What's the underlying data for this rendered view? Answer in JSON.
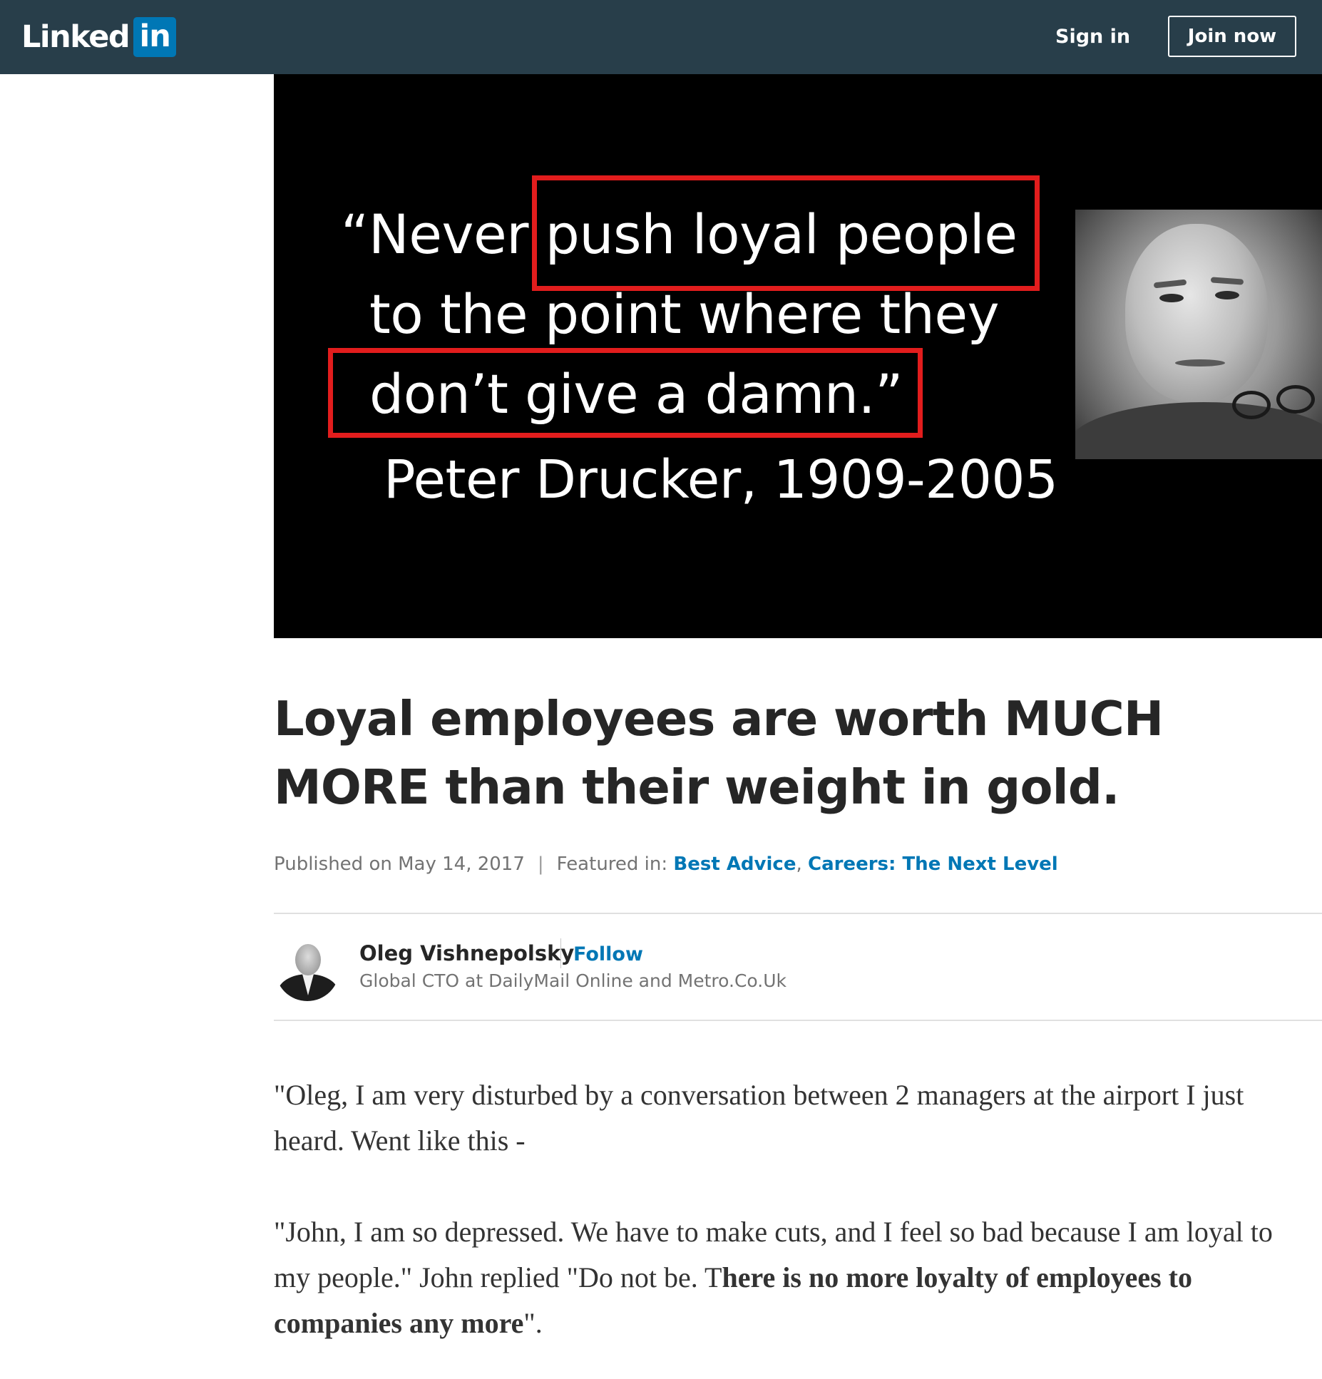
{
  "header": {
    "logo_word": "Linked",
    "logo_box": "in",
    "signin_label": "Sign in",
    "join_label": "Join now"
  },
  "hero": {
    "quote_line1_pre": "“Never ",
    "quote_line1_boxed": "push loyal people",
    "quote_line2": "to the point where they",
    "quote_line3_boxed": "don’t give a damn.”",
    "attribution": "Peter Drucker, 1909-2005"
  },
  "article": {
    "title": "Loyal employees are worth MUCH MORE than their weight in gold.",
    "published": "Published on May 14, 2017",
    "separator": "|",
    "featured_label": "Featured in:",
    "featured_links": [
      "Best Advice",
      "Careers: The Next Level"
    ],
    "featured_comma": ","
  },
  "author": {
    "name": "Oleg Vishnepolsky",
    "follow_label": "Follow",
    "headline": "Global CTO at DailyMail Online and Metro.Co.Uk"
  },
  "body": {
    "p1": "\"Oleg, I am very disturbed by a conversation between 2 managers at the airport I just heard. Went like this -",
    "p2_plain": "\"John, I am so depressed. We have to make cuts, and I feel so bad because I am loyal to my people.\" John replied \"Do not be. T",
    "p2_bold": "here is no more loyalty of employees to companies any more",
    "p2_end": "\"."
  },
  "colors": {
    "nav_bg": "#283e4a",
    "brand_blue": "#0077b5",
    "highlight_red": "#e21d1d"
  }
}
